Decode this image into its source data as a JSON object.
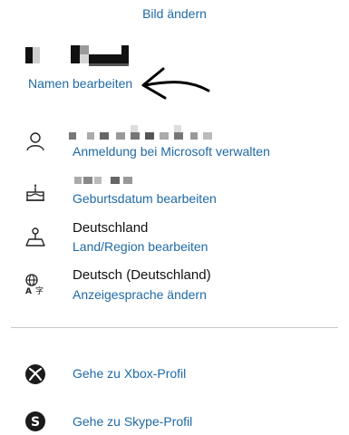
{
  "profile": {
    "change_image_label": "Bild ändern",
    "edit_name_label": "Namen bearbeiten"
  },
  "account": {
    "signin_label": "Anmeldung bei Microsoft verwalten",
    "birthday_label": "Geburtsdatum bearbeiten",
    "country_value": "Deutschland",
    "country_label": "Land/Region bearbeiten",
    "language_value": "Deutsch (Deutschland)",
    "language_label": "Anzeigesprache ändern"
  },
  "links": {
    "xbox_label": "Gehe zu Xbox-Profil",
    "skype_label": "Gehe zu Skype-Profil"
  },
  "icons": {
    "person": "person-icon",
    "cake": "birthday-cake-icon",
    "map": "map-pin-icon",
    "language": "language-globe-icon",
    "xbox": "xbox-icon",
    "skype": "skype-icon"
  },
  "colors": {
    "link": "#1f6aa5",
    "text": "#111111",
    "divider": "#c8c8c8"
  }
}
